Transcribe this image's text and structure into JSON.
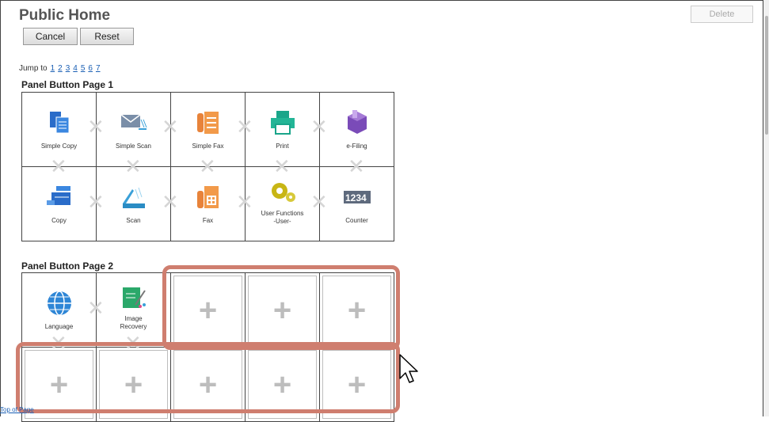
{
  "header": {
    "title": "Public Home",
    "cancel_label": "Cancel",
    "reset_label": "Reset",
    "delete_label": "Delete"
  },
  "jump": {
    "label": "Jump to",
    "pages": [
      "1",
      "2",
      "3",
      "4",
      "5",
      "6",
      "7"
    ]
  },
  "page1": {
    "title": "Panel Button Page 1",
    "buttons": [
      {
        "label": "Simple Copy",
        "icon": "simple-copy-icon"
      },
      {
        "label": "Simple Scan",
        "icon": "simple-scan-icon"
      },
      {
        "label": "Simple Fax",
        "icon": "simple-fax-icon"
      },
      {
        "label": "Print",
        "icon": "print-icon"
      },
      {
        "label": "e-Filing",
        "icon": "e-filing-icon"
      },
      {
        "label": "Copy",
        "icon": "copy-icon"
      },
      {
        "label": "Scan",
        "icon": "scan-icon"
      },
      {
        "label": "Fax",
        "icon": "fax-icon"
      },
      {
        "label": "User Functions\n-User-",
        "icon": "user-functions-icon"
      },
      {
        "label": "Counter",
        "icon": "counter-icon"
      }
    ]
  },
  "page2": {
    "title": "Panel Button Page 2",
    "buttons": [
      {
        "label": "Language",
        "icon": "language-icon"
      },
      {
        "label": "Image\nRecovery",
        "icon": "image-recovery-icon"
      }
    ],
    "empty_icon": "plus-icon"
  },
  "footer": {
    "top_link": "Top of Page"
  },
  "colors": {
    "highlight": "#cf7e6f",
    "link": "#1a5fb4"
  }
}
